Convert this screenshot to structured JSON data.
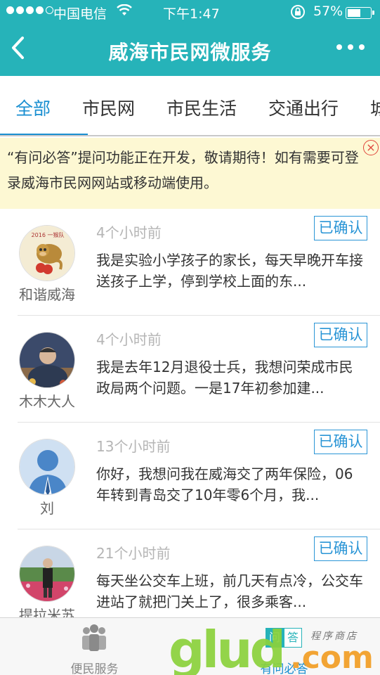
{
  "status_bar": {
    "carrier": "中国电信",
    "time": "下午1:47",
    "battery_percent": "57%",
    "battery_level": 0.57,
    "signal_bars_filled": 4,
    "signal_bars_total": 5
  },
  "nav": {
    "back_icon": "chevron-left-icon",
    "title": "威海市民网微服务",
    "more_icon": "more-dots-icon"
  },
  "tabs": [
    {
      "label": "全部",
      "active": true
    },
    {
      "label": "市民网",
      "active": false
    },
    {
      "label": "市民生活",
      "active": false
    },
    {
      "label": "交通出行",
      "active": false
    },
    {
      "label": "城",
      "active": false
    }
  ],
  "notice": {
    "text": "“有问必答”提问功能正在开发，敬请期待！如有需要可登录威海市民网网站或移动端使用。",
    "close_icon": "close-circle-icon"
  },
  "questions": [
    {
      "user": "和谐威海",
      "time_ago": "4个小时前",
      "status": "已确认",
      "text": "我是实验小学孩子的家长，每天早晚开车接送孩子上学，停到学校上面的东...",
      "avatar_text": "2016 一猴队"
    },
    {
      "user": "木木大人",
      "time_ago": "4个小时前",
      "status": "已确认",
      "text": "我是去年12月退役士兵，我想问荣成市民政局两个问题。一是17年初参加建..."
    },
    {
      "user": "刘",
      "time_ago": "13个小时前",
      "status": "已确认",
      "text": "你好，我想问我在威海交了两年保险，06年转到青岛交了10年零6个月，我..."
    },
    {
      "user": "提拉米苏",
      "time_ago": "21个小时前",
      "status": "已确认",
      "text": "每天坐公交车上班，前几天有点冷，公交车进站了就把门关上了，很多乘客..."
    }
  ],
  "tabbar": {
    "items": [
      {
        "label": "便民服务",
        "icon": "people-icon",
        "active": false
      },
      {
        "label": "有问必答",
        "icon": "qa-bubble-icon",
        "active": true
      }
    ],
    "qa_icon_text": [
      "问",
      "答"
    ]
  },
  "watermark": {
    "brand": "glud",
    "suffix": ".com",
    "tagline": "程序商店"
  },
  "colors": {
    "header": "#26b3b9",
    "accent": "#1a8fd1",
    "notice_bg": "#fdf8d3",
    "close": "#e0463c"
  }
}
